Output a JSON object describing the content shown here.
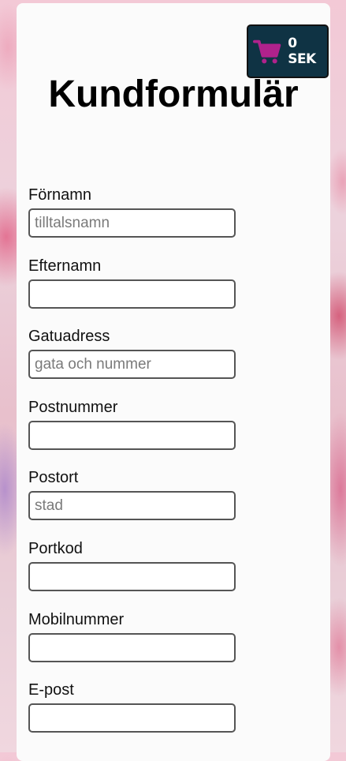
{
  "cart": {
    "total": "0 SEK",
    "icon": "shopping-cart-icon",
    "icon_color": "#b0228c",
    "bg_color": "#0f3344"
  },
  "page": {
    "title": "Kundformulär"
  },
  "form": {
    "fields": [
      {
        "label": "Förnamn",
        "placeholder": "tilltalsnamn",
        "value": ""
      },
      {
        "label": "Efternamn",
        "placeholder": "",
        "value": ""
      },
      {
        "label": "Gatuadress",
        "placeholder": "gata och nummer",
        "value": ""
      },
      {
        "label": "Postnummer",
        "placeholder": "",
        "value": ""
      },
      {
        "label": "Postort",
        "placeholder": "stad",
        "value": ""
      },
      {
        "label": "Portkod",
        "placeholder": "",
        "value": ""
      },
      {
        "label": "Mobilnummer",
        "placeholder": "",
        "value": ""
      },
      {
        "label": "E-post",
        "placeholder": "",
        "value": ""
      }
    ]
  }
}
